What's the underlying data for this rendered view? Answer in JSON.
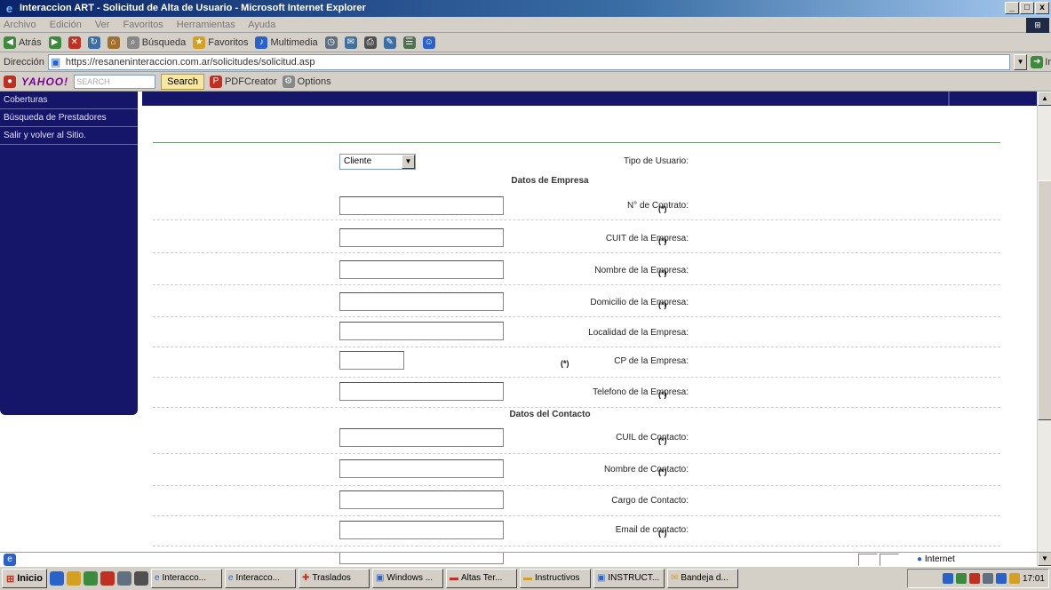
{
  "window": {
    "title": "Interaccion ART - Solicitud de Alta de Usuario - Microsoft Internet Explorer",
    "buttons": [
      "_",
      "□",
      "x"
    ]
  },
  "menu": [
    "Archivo",
    "Edición",
    "Ver",
    "Favoritos",
    "Herramientas",
    "Ayuda"
  ],
  "toolbar": {
    "back": "Atrás",
    "search": "Búsqueda",
    "favorites": "Favoritos",
    "multimedia": "Multimedia"
  },
  "address": {
    "label": "Dirección",
    "url": "https://resaneninteraccion.com.ar/solicitudes/solicitud.asp",
    "go": "Ir"
  },
  "links": {
    "yahoo": "YAHOO!",
    "search_placeholder": "SEARCH",
    "search_button": "Search",
    "pdf": "PDFCreator",
    "options": "Options"
  },
  "sidebar": {
    "items": [
      "Coberturas",
      "Búsqueda de Prestadores",
      "Salir y volver al Sitio."
    ]
  },
  "form": {
    "tipo_label": "Tipo de Usuario:",
    "tipo_value": "Cliente",
    "section_empresa": "Datos de Empresa",
    "section_contacto": "Datos del Contacto",
    "required_mark": "(*)",
    "fields": [
      {
        "label": "N° de Contrato:"
      },
      {
        "label": "CUIT de la Empresa:"
      },
      {
        "label": "Nombre de la Empresa:"
      },
      {
        "label": "Domicilio de la Empresa:"
      },
      {
        "label": "Localidad de la Empresa:"
      },
      {
        "label": "CP de la Empresa:"
      },
      {
        "label": "Telefono de la Empresa:"
      },
      {
        "label": "CUIL de Contacto:"
      },
      {
        "label": "Nombre de Contacto:"
      },
      {
        "label": "Cargo de Contacto:"
      },
      {
        "label": "Email de contacto:"
      }
    ]
  },
  "status": {
    "zone": "Internet"
  },
  "taskbar": {
    "start": "Inicio",
    "tasks": [
      "Interacco...",
      "Interacco...",
      "Traslados",
      "Windows ...",
      "Altas Ter...",
      "Instructivos",
      "INSTRUCT...",
      "Bandeja d..."
    ],
    "clock": "17:01"
  }
}
